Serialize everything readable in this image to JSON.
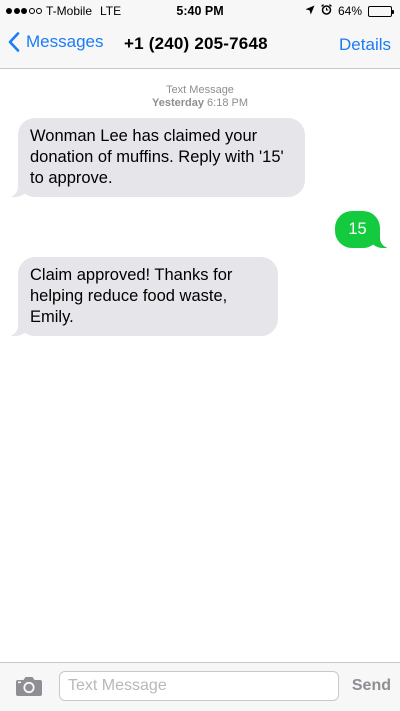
{
  "status_bar": {
    "carrier": "T-Mobile",
    "network": "LTE",
    "time": "5:40 PM",
    "battery": "64%",
    "battery_level": 0.64,
    "signal_bars_filled": 3,
    "signal_bars_total": 5
  },
  "nav": {
    "back_label": "Messages",
    "title": "+1 (240) 205-7648",
    "details_label": "Details"
  },
  "conversation": {
    "header_label": "Text Message",
    "header_day": "Yesterday",
    "header_time": "6:18 PM",
    "messages": [
      {
        "direction": "incoming",
        "text": "Wonman Lee has claimed your donation of muffins.  Reply with '15' to approve."
      },
      {
        "direction": "outgoing",
        "text": "15"
      },
      {
        "direction": "incoming",
        "text": "Claim approved!  Thanks for helping reduce food waste, Emily."
      }
    ]
  },
  "input_bar": {
    "placeholder": "Text Message",
    "value": "",
    "send_label": "Send",
    "camera_icon": "camera-icon"
  },
  "colors": {
    "accent": "#1b7cf5",
    "incoming_bubble": "#e5e5ea",
    "outgoing_bubble": "#14cb3f",
    "bar_background": "#f7f7f8"
  }
}
